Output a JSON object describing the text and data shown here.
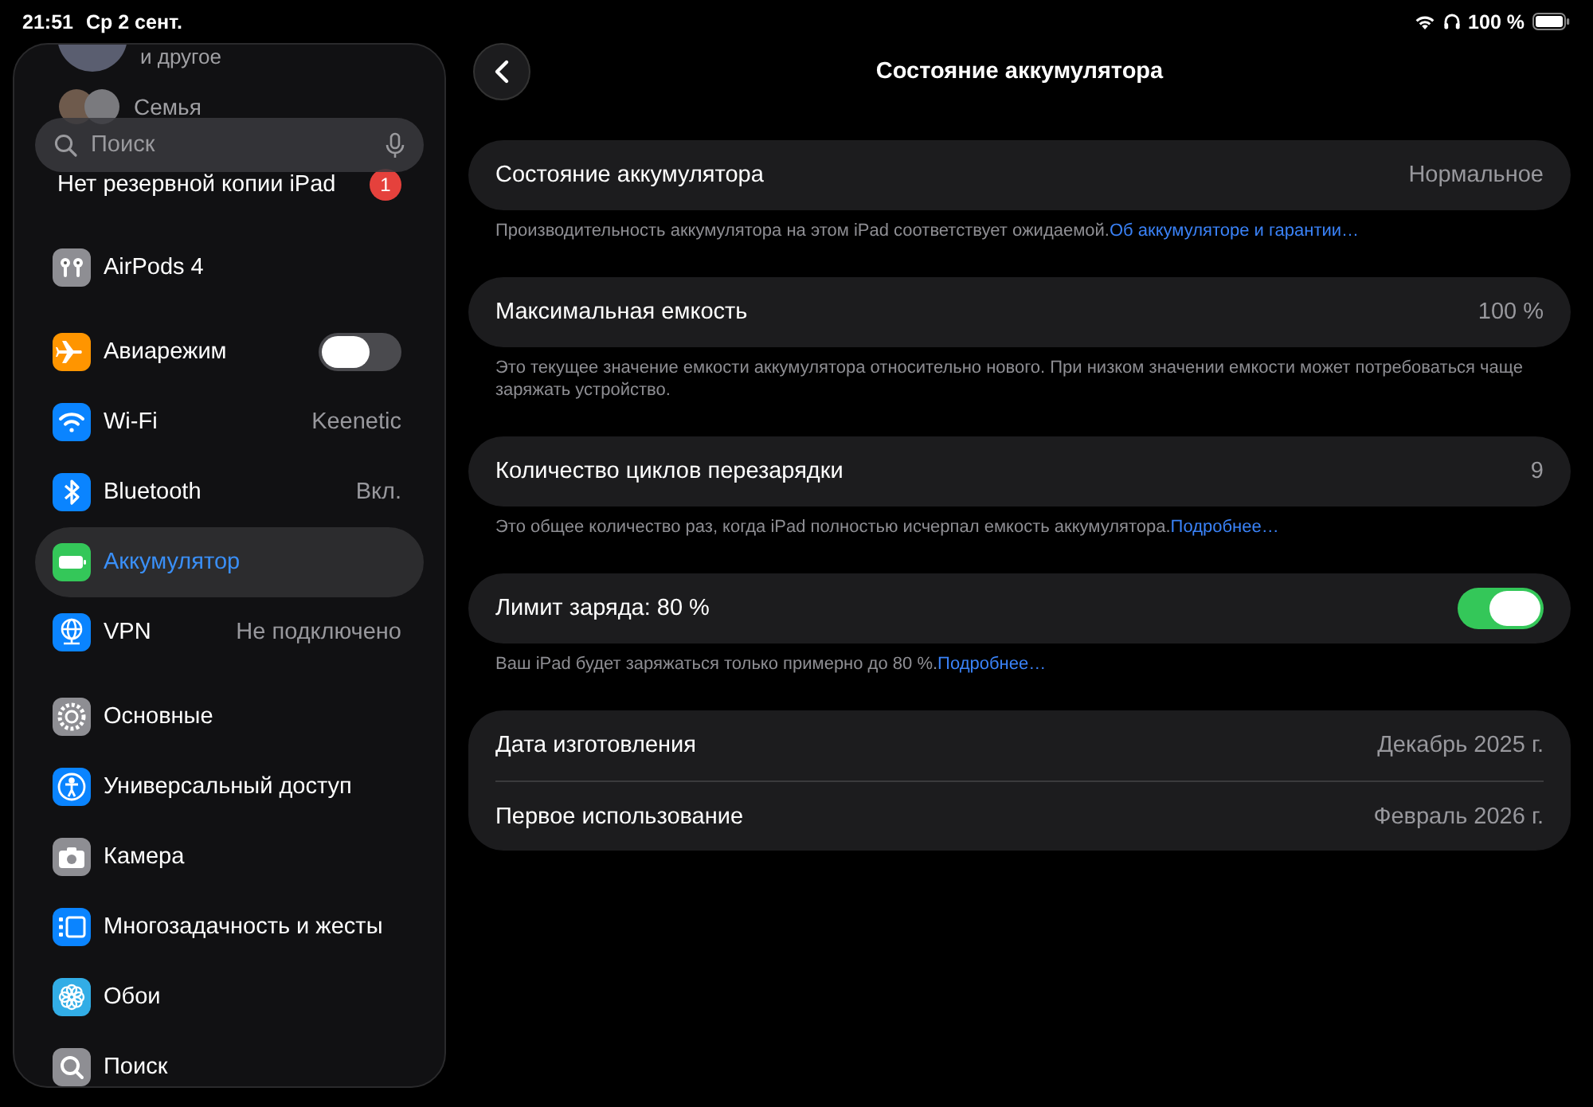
{
  "status_bar": {
    "time": "21:51",
    "date": "Ср 2 сент.",
    "battery": "100 %"
  },
  "sidebar": {
    "faded_items": [
      {
        "kind": "account",
        "label": "и другое"
      },
      {
        "kind": "family",
        "label": "Семья"
      }
    ],
    "search": {
      "placeholder": "Поиск"
    },
    "groups": [
      {
        "items": [
          {
            "kind": "badge",
            "label": "Нет резервной копии iPad",
            "badge": "1",
            "selected": false
          }
        ]
      },
      {
        "items": [
          {
            "kind": "plain",
            "label": "AirPods 4",
            "selected": false
          }
        ]
      },
      {
        "items": [
          {
            "kind": "toggle",
            "label": "Авиарежим",
            "on": false,
            "selected": false
          },
          {
            "kind": "value",
            "label": "Wi-Fi",
            "value": "Keenetic",
            "selected": false
          },
          {
            "kind": "value",
            "label": "Bluetooth",
            "value": "Вкл.",
            "selected": false
          },
          {
            "kind": "plain",
            "label": "Аккумулятор",
            "selected": true
          },
          {
            "kind": "value",
            "label": "VPN",
            "value": "Не подключено",
            "selected": false
          }
        ]
      },
      {
        "items": [
          {
            "kind": "plain",
            "label": "Основные",
            "selected": false
          },
          {
            "kind": "plain",
            "label": "Универсальный доступ",
            "selected": false
          },
          {
            "kind": "plain",
            "label": "Камера",
            "selected": false
          },
          {
            "kind": "plain",
            "label": "Многозадачность и жесты",
            "selected": false
          },
          {
            "kind": "plain",
            "label": "Обои",
            "selected": false
          },
          {
            "kind": "plain",
            "label": "Поиск",
            "selected": false
          }
        ]
      }
    ]
  },
  "header": {
    "title": "Состояние аккумулятора"
  },
  "sections": [
    {
      "rows": [
        {
          "kind": "value",
          "label": "Состояние аккумулятора",
          "value": "Нормальное"
        }
      ],
      "footer": "Производительность аккумулятора на этом iPad соответствует ожидаемой.",
      "footer_link": "Об аккумуляторе и гарантии…"
    },
    {
      "rows": [
        {
          "kind": "value",
          "label": "Максимальная емкость",
          "value": "100 %"
        }
      ],
      "footer": "Это текущее значение емкости аккумулятора относительно нового. При низком значении емкости может потребоваться чаще заряжать устройство."
    },
    {
      "rows": [
        {
          "kind": "value",
          "label": "Количество циклов перезарядки",
          "value": "9"
        }
      ],
      "footer": "Это общее количество раз, когда iPad полностью исчерпал емкость аккумулятора.",
      "footer_link": "Подробнее…"
    },
    {
      "rows": [
        {
          "kind": "toggle",
          "label": "Лимит заряда: 80 %",
          "on": true
        }
      ],
      "footer": "Ваш iPad будет заряжаться только примерно до 80 %.",
      "footer_link": "Подробнее…"
    },
    {
      "rows": [
        {
          "kind": "value",
          "label": "Дата изготовления",
          "value": "Декабрь 2025 г."
        },
        {
          "kind": "value",
          "label": "Первое использование",
          "value": "Февраль 2026 г."
        }
      ]
    }
  ]
}
